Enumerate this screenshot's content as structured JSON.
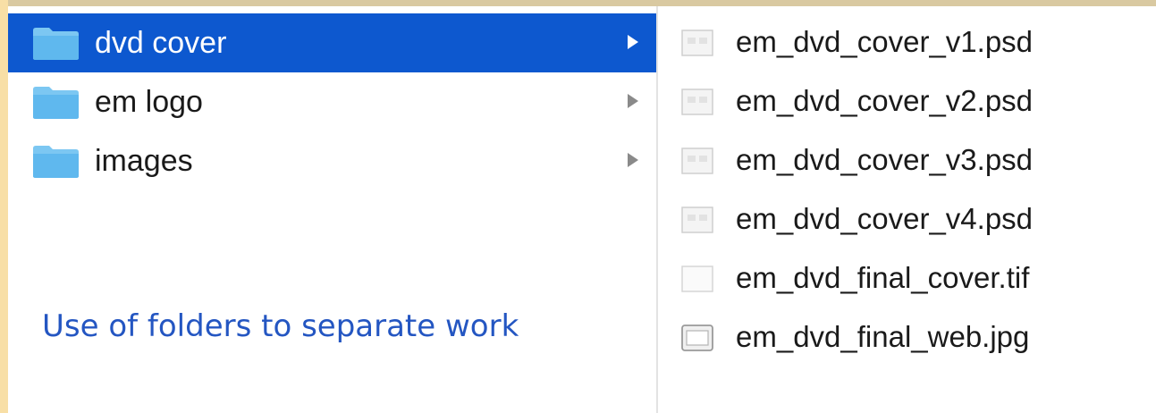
{
  "folders": [
    {
      "label": "dvd cover",
      "selected": true
    },
    {
      "label": "em logo",
      "selected": false
    },
    {
      "label": "images",
      "selected": false
    }
  ],
  "files": [
    {
      "label": "em_dvd_cover_v1.psd",
      "icon": "psd-file-icon"
    },
    {
      "label": "em_dvd_cover_v2.psd",
      "icon": "psd-file-icon"
    },
    {
      "label": "em_dvd_cover_v3.psd",
      "icon": "psd-file-icon"
    },
    {
      "label": "em_dvd_cover_v4.psd",
      "icon": "psd-file-icon"
    },
    {
      "label": "em_dvd_final_cover.tif",
      "icon": "tif-file-icon"
    },
    {
      "label": "em_dvd_final_web.jpg",
      "icon": "jpg-file-icon"
    }
  ],
  "caption": "Use of folders to separate work",
  "colors": {
    "selection": "#0d58cf",
    "folder": "#5fb8ee",
    "caption": "#2456c2",
    "left_strip": "#f8dfa6"
  }
}
